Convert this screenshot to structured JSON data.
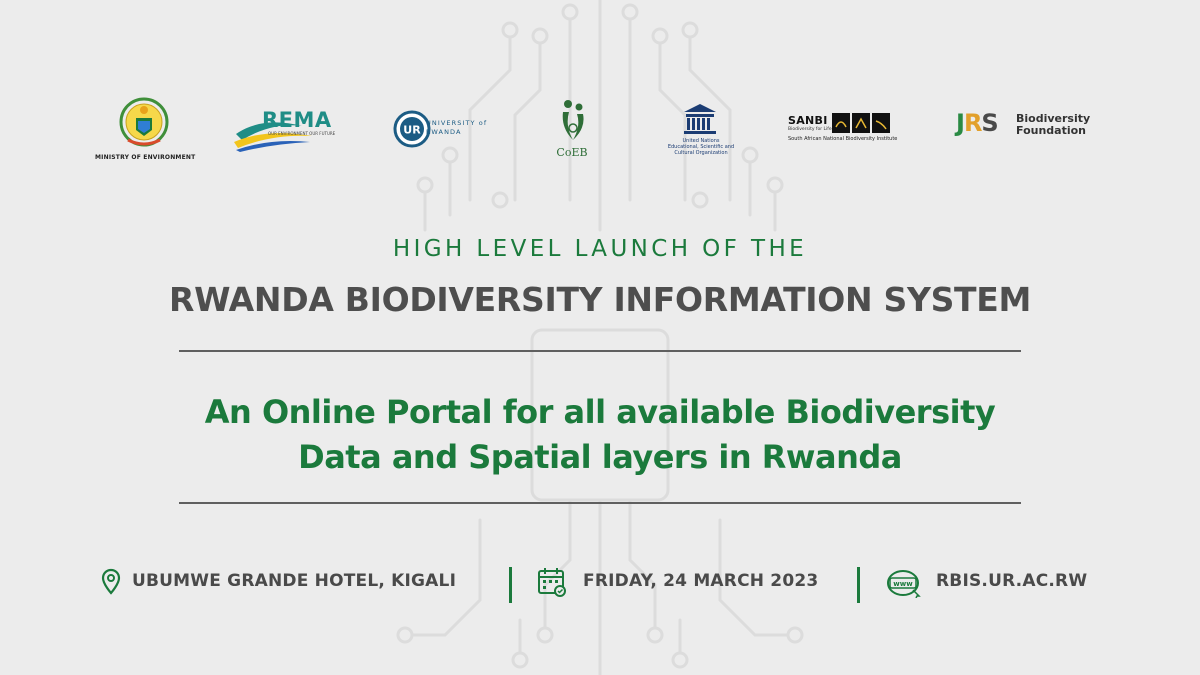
{
  "logos": {
    "ministry": {
      "caption": "MINISTRY OF ENVIRONMENT"
    },
    "rema": {
      "name": "REMA",
      "tagline": "OUR ENVIRONMENT OUR FUTURE"
    },
    "university": {
      "line1": "UNIVERSITY of",
      "line2": "RWANDA"
    },
    "coeb": {
      "name": "CoEB"
    },
    "unesco": {
      "line1": "United Nations",
      "line2": "Educational, Scientific and",
      "line3": "Cultural Organization"
    },
    "sanbi": {
      "name": "SANBI",
      "subtitle": "Biodiversity for Life",
      "fullname": "South African National Biodiversity Institute"
    },
    "jrs": {
      "j": "J",
      "r": "R",
      "s": "S",
      "line1": "Biodiversity",
      "line2": "Foundation"
    }
  },
  "headline": {
    "top": "HIGH LEVEL LAUNCH OF THE",
    "main": "RWANDA BIODIVERSITY INFORMATION SYSTEM"
  },
  "tagline": {
    "line1": "An Online Portal for all available Biodiversity",
    "line2": "Data and Spatial layers in Rwanda"
  },
  "info": {
    "venue": "UBUMWE GRANDE HOTEL, KIGALI",
    "date": "FRIDAY, 24 MARCH 2023",
    "website": "RBIS.UR.AC.RW",
    "website_badge": "www"
  },
  "icons": {
    "location": "location-pin-icon",
    "calendar": "calendar-icon",
    "web": "globe-icon"
  },
  "colors": {
    "background": "#ececec",
    "accent_green": "#1b7a3c",
    "heading_grey": "#4e4e4e",
    "rule_grey": "#5f5f5f"
  }
}
